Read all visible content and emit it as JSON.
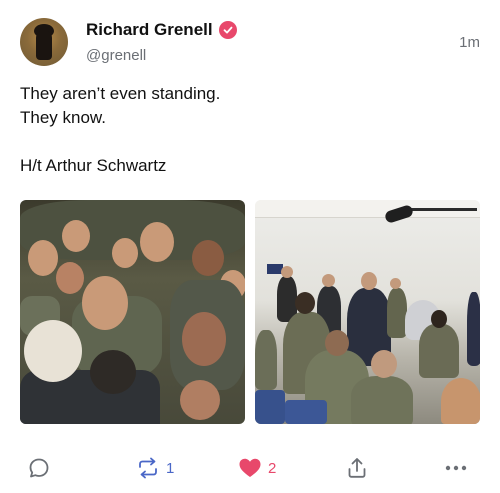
{
  "author": {
    "display_name": "Richard Grenell",
    "handle": "@grenell",
    "verified": true,
    "avatar": "avatar"
  },
  "post": {
    "timestamp": "1m",
    "text": "They aren’t even standing.\nThey know.\n\nH/t Arthur Schwartz"
  },
  "images": [
    {
      "name": "crowd-photo"
    },
    {
      "name": "room-photo"
    }
  ],
  "actions": {
    "reply_icon": "reply-icon",
    "repost_icon": "repost-icon",
    "repost_count": "1",
    "like_icon": "heart-icon",
    "like_count": "2",
    "share_icon": "share-icon",
    "more_icon": "more-icon"
  },
  "colors": {
    "accent": "#e8486b",
    "repost": "#4a67c7",
    "muted": "#6b6f75"
  }
}
